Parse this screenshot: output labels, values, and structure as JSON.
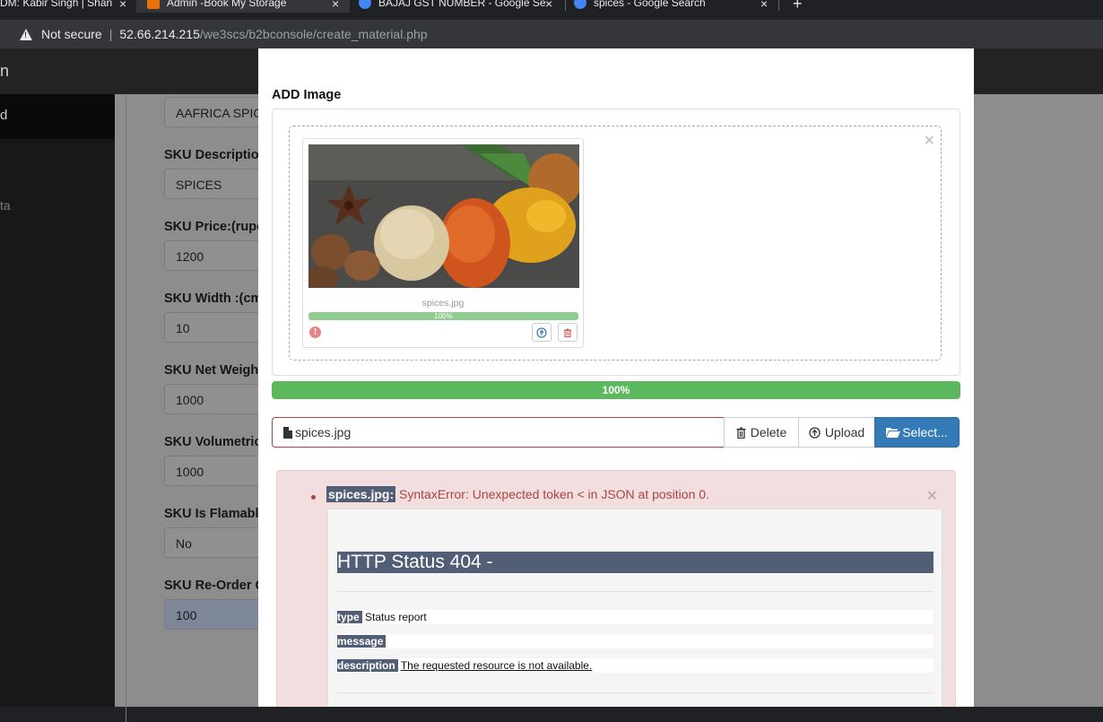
{
  "browser": {
    "tabs": [
      {
        "title": "DM: Kabir Singh | Shan",
        "favicon_color": "#9aa0a6"
      },
      {
        "title": "Admin -Book My Storage",
        "favicon_color": "#e8710a"
      },
      {
        "title": "BAJAJ GST NUMBER - Google Se",
        "favicon_color": "#4285f4"
      },
      {
        "title": "spices - Google Search",
        "favicon_color": "#4285f4"
      }
    ],
    "new_tab": "+",
    "tab_close": "×",
    "security_label": "Not secure",
    "url_host": "52.66.214.215",
    "url_path": "/we3scs/b2bconsole/create_material.php"
  },
  "background_page": {
    "brand": "n",
    "sidebar": {
      "active_item": "d",
      "item": "ta"
    },
    "fields": [
      {
        "label": "",
        "value": "AAFRICA SPICES"
      },
      {
        "label": "SKU Description:",
        "value": "SPICES"
      },
      {
        "label": "SKU Price:(rupee",
        "value": "1200"
      },
      {
        "label": "SKU Width :(cm)",
        "value": "10"
      },
      {
        "label": "SKU Net Weight:",
        "value": "1000"
      },
      {
        "label": "SKU Volumetric W",
        "value": "1000"
      },
      {
        "label": "SKU Is Flamable",
        "value": "No"
      },
      {
        "label": "SKU Re-Order Qu",
        "value": "100"
      }
    ]
  },
  "modal": {
    "title": "ADD Image",
    "dropzone_close": "×",
    "preview": {
      "file_name": "spices.jpg",
      "progress": 100,
      "progress_label": "100%",
      "error_glyph": "!"
    },
    "overall_progress": 100,
    "overall_progress_label": "100%",
    "file_caption": "spices.jpg",
    "buttons": {
      "delete": "Delete",
      "upload": "Upload",
      "select": "Select..."
    },
    "error": {
      "file_label": "spices.jpg:",
      "message": " SyntaxError: Unexpected token < in JSON at position 0.",
      "close": "×",
      "http_title": "HTTP Status 404 -",
      "type_label": "type",
      "type_value": " Status report",
      "message_label": "message",
      "description_label": "description",
      "description_value": "The requested resource is not available."
    }
  }
}
